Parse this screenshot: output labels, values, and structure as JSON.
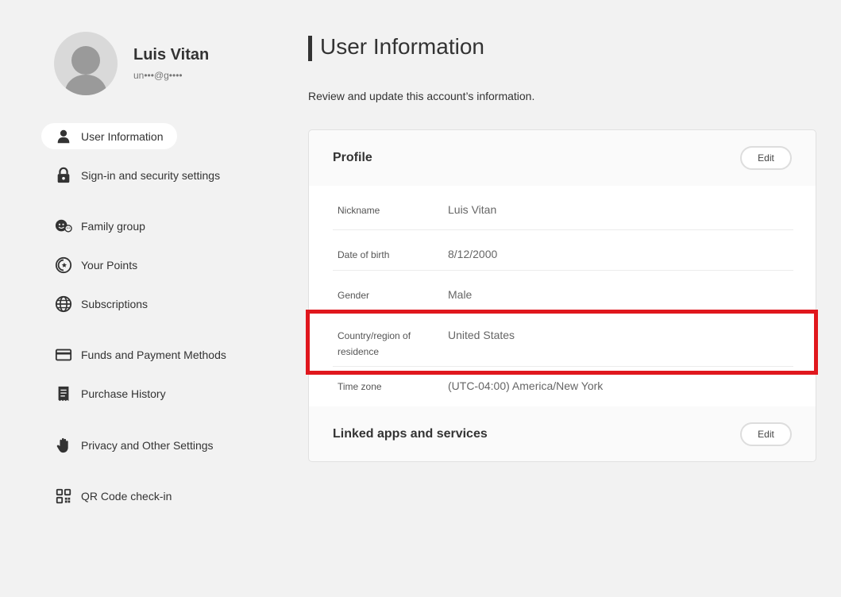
{
  "user": {
    "name": "Luis Vitan",
    "email": "un•••@g••••"
  },
  "sidebar": {
    "items": [
      {
        "label": "User Information",
        "icon": "person-icon",
        "active": true
      },
      {
        "label": "Sign-in and security settings",
        "icon": "lock-icon"
      },
      {
        "label": "Family group",
        "icon": "family-icon"
      },
      {
        "label": "Your Points",
        "icon": "points-coin-icon"
      },
      {
        "label": "Subscriptions",
        "icon": "globe-icon"
      },
      {
        "label": "Funds and Payment Methods",
        "icon": "credit-card-icon"
      },
      {
        "label": "Purchase History",
        "icon": "receipt-icon"
      },
      {
        "label": "Privacy and Other Settings",
        "icon": "hand-icon"
      },
      {
        "label": "QR Code check-in",
        "icon": "qr-code-icon"
      }
    ]
  },
  "main": {
    "title": "User Information",
    "description": "Review and update this account’s information.",
    "profile": {
      "title": "Profile",
      "edit_label": "Edit",
      "rows": [
        {
          "label": "Nickname",
          "value": "Luis Vitan"
        },
        {
          "label": "Date of birth",
          "value": "8/12/2000"
        },
        {
          "label": "Gender",
          "value": "Male"
        },
        {
          "label": "Country/region of residence",
          "value": "United States"
        },
        {
          "label": "Time zone",
          "value": "(UTC-04:00) America/New York"
        }
      ]
    },
    "linked": {
      "title": "Linked apps and services",
      "edit_label": "Edit"
    }
  },
  "colors": {
    "background": "#f2f2f2",
    "highlight": "#e0171d",
    "text": "#333333"
  }
}
